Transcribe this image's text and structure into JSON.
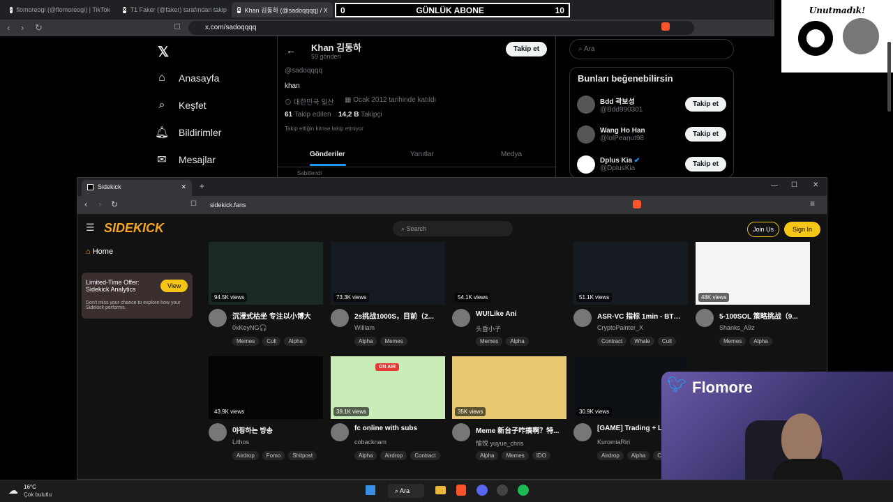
{
  "back_browser": {
    "tabs": [
      "flomoreogi (@flomoreogi) | TikTok",
      "T1 Faker (@faker) tarafından takip ed",
      "Khan 김동하 (@sadoqqqq) / X"
    ],
    "url": "x.com/sadoqqqq"
  },
  "overlay": {
    "label": "GÜNLÜK ABONE",
    "left_value": "0",
    "right_value": "10",
    "unutmadik": "Unutmadık!"
  },
  "twitter": {
    "nav": [
      "Anasayfa",
      "Keşfet",
      "Bildirimler",
      "Mesajlar"
    ],
    "profile": {
      "name": "Khan 김동하",
      "posts": "59 gönderi",
      "handle": "@sadoqqqq",
      "bio": "khan",
      "location": "대한민국 일산",
      "joined": "Ocak 2012 tarihinde katıldı",
      "following_count": "61",
      "following_label": "Takip edilen",
      "followers_count": "14,2 B",
      "followers_label": "Takipçi",
      "note": "Takip ettiğin kimse takip etmiyor",
      "follow_button": "Takip et",
      "tabs": [
        "Gönderiler",
        "Yanıtlar",
        "Medya"
      ],
      "pinned": "Sabitlendi"
    },
    "search_placeholder": "Ara",
    "suggest_title": "Bunları beğenebilirsin",
    "suggestions": [
      {
        "name": "Bdd 곽보성",
        "handle": "@Bdd990301",
        "button": "Takip et"
      },
      {
        "name": "Wang Ho Han",
        "handle": "@lolPeanut98",
        "button": "Takip et"
      },
      {
        "name": "Dplus Kia",
        "handle": "@DplusKia",
        "button": "Takip et"
      }
    ]
  },
  "front_browser": {
    "tab": "Sidekick",
    "url": "sidekick.fans",
    "window_controls": [
      "—",
      "☐",
      "✕"
    ]
  },
  "sidekick": {
    "logo": "SIDEKICK",
    "search_placeholder": "Search",
    "join": "Join Us",
    "signin": "Sign In",
    "home": "Home",
    "offer": {
      "title": "Limited-Time Offer: Sidekick Analytics",
      "button": "View",
      "desc": "Don't miss your chance to explore how your Sidekick performs."
    },
    "cards_row1": [
      {
        "views": "94.5K views",
        "title": "沉浸式枯坐 专注以小博大",
        "author": "0xKeyNG🎧",
        "tags": [
          "Memes",
          "Cult",
          "Alpha"
        ]
      },
      {
        "views": "73.3K views",
        "title": "2s挑战1000S，目前（2...",
        "author": "William",
        "tags": [
          "Alpha",
          "Memes"
        ]
      },
      {
        "views": "54.1K views",
        "title": "WU!Like Ani",
        "author": "头昏小子",
        "tags": [
          "Memes",
          "Alpha"
        ]
      },
      {
        "views": "51.1K views",
        "title": "ASR-VC 指标 1min - BTC...",
        "author": "CryptoPainter_X",
        "tags": [
          "Contract",
          "Whale",
          "Cult"
        ]
      },
      {
        "views": "48K views",
        "title": "5-100SOL 策略挑战（9...",
        "author": "Shanks_A9z",
        "tags": [
          "Memes",
          "Alpha"
        ]
      }
    ],
    "cards_row2": [
      {
        "views": "43.9K views",
        "title": "야핑하는 방송",
        "author": "Lithos",
        "tags": [
          "Airdrop",
          "Fomo",
          "Shitpost"
        ]
      },
      {
        "views": "39.1K views",
        "title": "fc online with subs",
        "author": "cobacknam",
        "tags": [
          "Alpha",
          "Airdrop",
          "Contract"
        ]
      },
      {
        "views": "35K views",
        "title": "Meme 新台子咋搞啊？特...",
        "author": "愉悦 yuyue_chris",
        "tags": [
          "Alpha",
          "Memes",
          "IDO"
        ]
      },
      {
        "views": "30.9K views",
        "title": "[GAME] Trading + LO",
        "author": "KuromiaRiri",
        "tags": [
          "Airdrop",
          "Alpha",
          "Cult"
        ]
      }
    ],
    "on_air": "ON AIR"
  },
  "webcam": {
    "name": "Flomore"
  },
  "taskbar": {
    "temp": "16°C",
    "weather": "Çok bulutlu",
    "search": "Ara"
  }
}
